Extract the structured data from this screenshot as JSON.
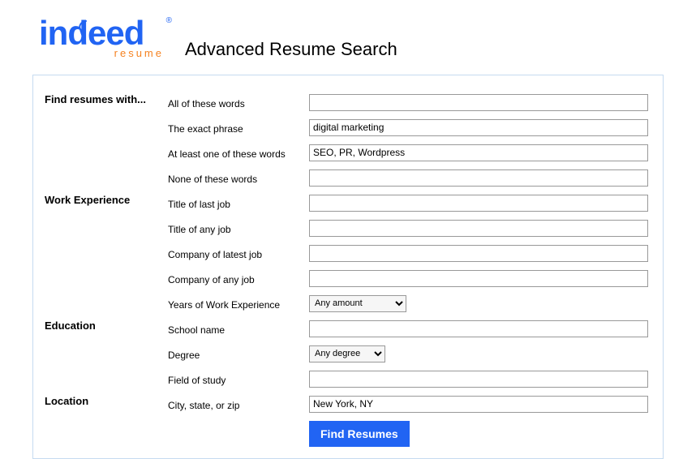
{
  "logo": {
    "main": "indeed",
    "sub": "resume",
    "reg": "®"
  },
  "page_title": "Advanced Resume Search",
  "sections": {
    "find": {
      "heading": "Find resumes with...",
      "all_words_label": "All of these words",
      "exact_phrase_label": "The exact phrase",
      "at_least_one_label": "At least one of these words",
      "none_label": "None of these words",
      "all_words_value": "",
      "exact_phrase_value": "digital marketing",
      "at_least_one_value": "SEO, PR, Wordpress",
      "none_value": ""
    },
    "work": {
      "heading": "Work Experience",
      "title_last_label": "Title of last job",
      "title_any_label": "Title of any job",
      "company_latest_label": "Company of latest job",
      "company_any_label": "Company of any job",
      "years_label": "Years of Work Experience",
      "title_last_value": "",
      "title_any_value": "",
      "company_latest_value": "",
      "company_any_value": "",
      "years_selected": "Any amount"
    },
    "education": {
      "heading": "Education",
      "school_label": "School name",
      "degree_label": "Degree",
      "field_label": "Field of study",
      "school_value": "",
      "degree_selected": "Any degree",
      "field_value": ""
    },
    "location": {
      "heading": "Location",
      "city_label": "City, state, or zip",
      "city_value": "New York, NY"
    }
  },
  "submit_label": "Find Resumes"
}
